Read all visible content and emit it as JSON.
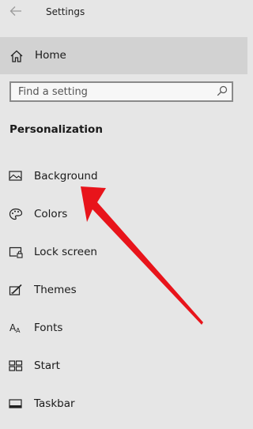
{
  "window": {
    "title": "Settings"
  },
  "home": {
    "label": "Home",
    "icon": "home-icon"
  },
  "search": {
    "placeholder": "Find a setting",
    "value": ""
  },
  "section": {
    "title": "Personalization"
  },
  "nav_items": [
    {
      "label": "Background",
      "icon": "picture-icon"
    },
    {
      "label": "Colors",
      "icon": "palette-icon"
    },
    {
      "label": "Lock screen",
      "icon": "lock-screen-icon"
    },
    {
      "label": "Themes",
      "icon": "themes-icon"
    },
    {
      "label": "Fonts",
      "icon": "fonts-icon"
    },
    {
      "label": "Start",
      "icon": "start-icon"
    },
    {
      "label": "Taskbar",
      "icon": "taskbar-icon"
    }
  ],
  "annotation": {
    "arrow_color": "#e8141b",
    "points_to": "Background"
  },
  "colors": {
    "background": "#e6e6e6",
    "selected_row": "#d2d2d2"
  }
}
